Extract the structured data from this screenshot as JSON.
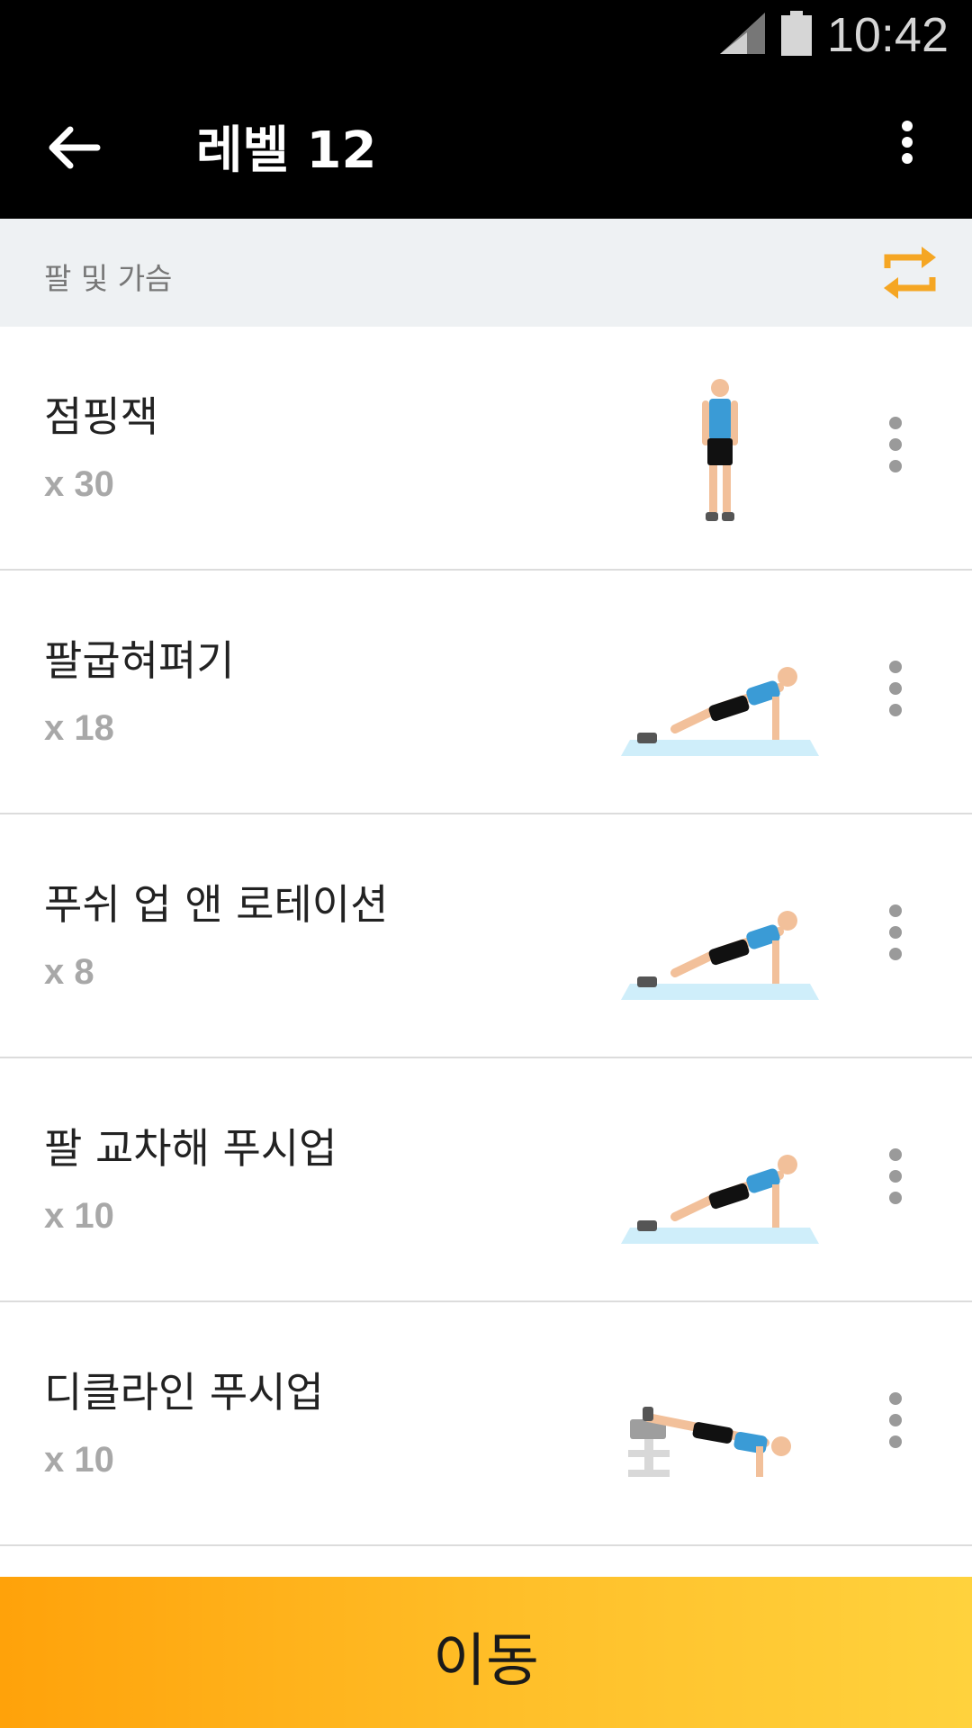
{
  "status_bar": {
    "time": "10:42",
    "signal_icon": "signal-icon",
    "battery_icon": "battery-icon"
  },
  "app_bar": {
    "title": "레벨 12",
    "back_icon": "arrow-back-icon",
    "menu_icon": "more-vert-icon"
  },
  "section": {
    "title": "팔 및 가슴",
    "action_icon": "repeat-icon",
    "accent": "#f5a623"
  },
  "exercises": [
    {
      "name": "점핑잭",
      "reps": "x 30",
      "illustration": "standing-man"
    },
    {
      "name": "팔굽혀펴기",
      "reps": "x 18",
      "illustration": "push-up"
    },
    {
      "name": "푸쉬 업 앤 로테이션",
      "reps": "x 8",
      "illustration": "push-up"
    },
    {
      "name": "팔 교차해 푸시업",
      "reps": "x 10",
      "illustration": "push-up"
    },
    {
      "name": "디클라인 푸시업",
      "reps": "x 10",
      "illustration": "decline-push-up"
    }
  ],
  "bottom_button": {
    "label": "이동",
    "gradient": [
      "#ffa20a",
      "#ffd23d"
    ]
  }
}
